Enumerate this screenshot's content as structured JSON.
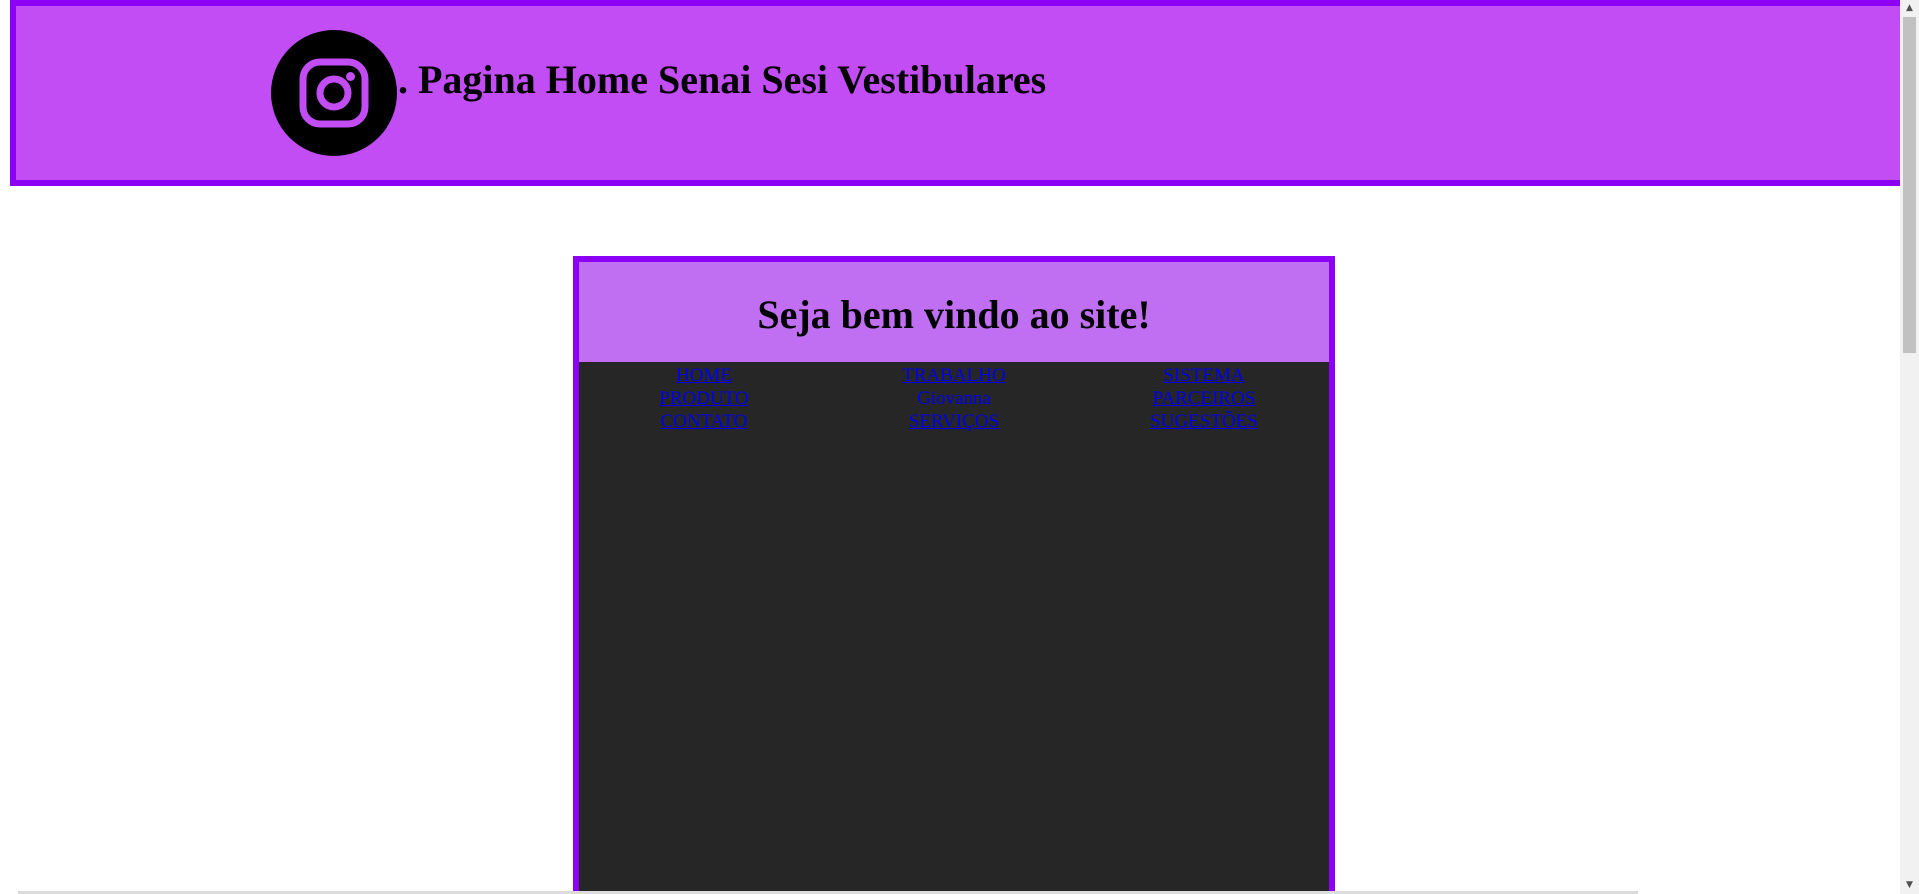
{
  "header": {
    "title": ". Pagina Home Senai Sesi Vestibulares",
    "logo_icon": "instagram-icon",
    "background": "#c24df5",
    "border": "#8c00f5"
  },
  "panel": {
    "title": "Seja bem vindo ao site!",
    "nav": {
      "col1": [
        "HOME",
        "PRODUTO",
        "CONTATO"
      ],
      "col2": [
        "TRABALHO",
        "Giovanna",
        "SERVIÇOS"
      ],
      "col3": [
        "SISTEMA",
        "PARCEIROS",
        "SUGESTÕES"
      ]
    },
    "head_background": "#c06ef2",
    "body_background": "#262626",
    "link_color": "#0000ee"
  }
}
